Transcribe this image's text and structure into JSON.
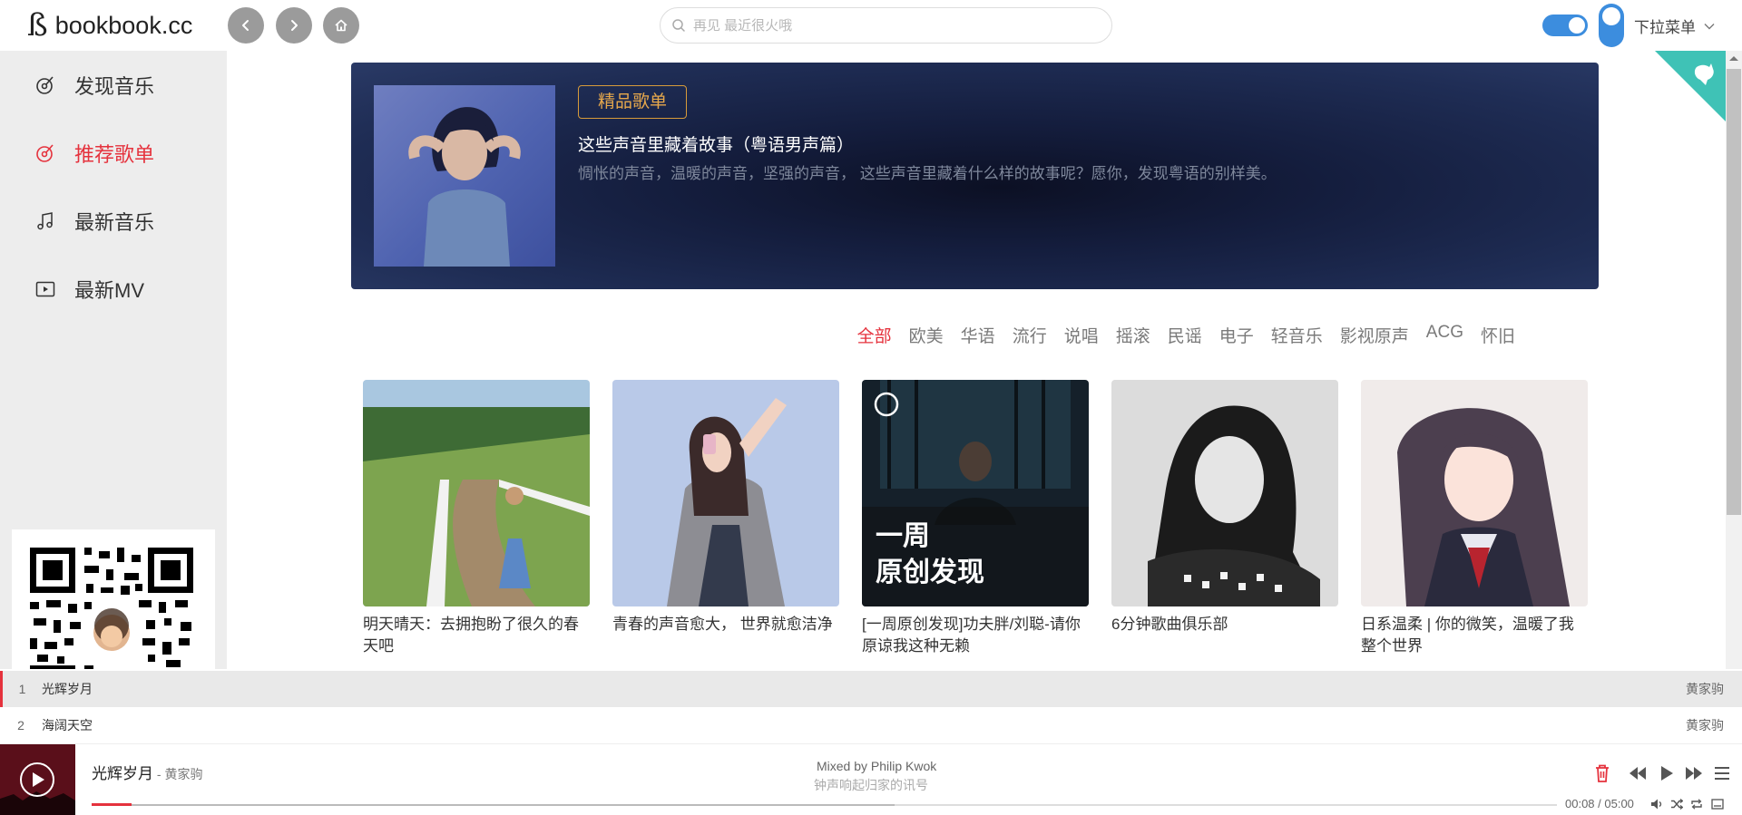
{
  "header": {
    "logo_text": "bookbook.cc",
    "search_placeholder": "再见 最近很火哦",
    "dropdown_label": "下拉菜单"
  },
  "sidebar": {
    "items": [
      {
        "label": "发现音乐",
        "icon": "music-disc-icon",
        "active": false
      },
      {
        "label": "推荐歌单",
        "icon": "music-disc-icon",
        "active": true
      },
      {
        "label": "最新音乐",
        "icon": "music-note-icon",
        "active": false
      },
      {
        "label": "最新MV",
        "icon": "video-play-icon",
        "active": false
      }
    ]
  },
  "banner": {
    "tag": "精品歌单",
    "title": "这些声音里藏着故事（粤语男声篇）",
    "description": "惆怅的声音，温暖的声音，坚强的声音， 这些声音里藏着什么样的故事呢？愿你，发现粤语的别样美。"
  },
  "categories": [
    "全部",
    "欧美",
    "华语",
    "流行",
    "说唱",
    "摇滚",
    "民谣",
    "电子",
    "轻音乐",
    "影视原声",
    "ACG",
    "怀旧"
  ],
  "active_category": "全部",
  "playlists": [
    {
      "name": "明天晴天：去拥抱盼了很久的春天吧"
    },
    {
      "name": "青春的声音愈大， 世界就愈洁净"
    },
    {
      "name": "[一周原创发现]功夫胖/刘聪-请你原谅我这种无赖",
      "overlay": "一周\n原创发现"
    },
    {
      "name": "6分钟歌曲俱乐部"
    },
    {
      "name": "日系温柔 | 你的微笑，温暖了我整个世界"
    }
  ],
  "overlay_line1": "一周",
  "overlay_line2": "原创发现",
  "queue": [
    {
      "num": "1",
      "song": "光辉岁月",
      "artist": "黄家驹",
      "active": true
    },
    {
      "num": "2",
      "song": "海阔天空",
      "artist": "黄家驹",
      "active": false
    }
  ],
  "player": {
    "title": "光辉岁月",
    "artist": "黄家驹",
    "artist_sep": " - ",
    "lyric_current": "Mixed by Philip Kwok",
    "lyric_next": "钟声响起归家的讯号",
    "time": "00:08 / 05:00",
    "progress": 0.027,
    "buffered": 0.548
  },
  "colors": {
    "accent": "#e5323d",
    "toggle": "#3c8dde",
    "banner_tag": "#e6a84c",
    "corner": "#3fc2b6"
  }
}
